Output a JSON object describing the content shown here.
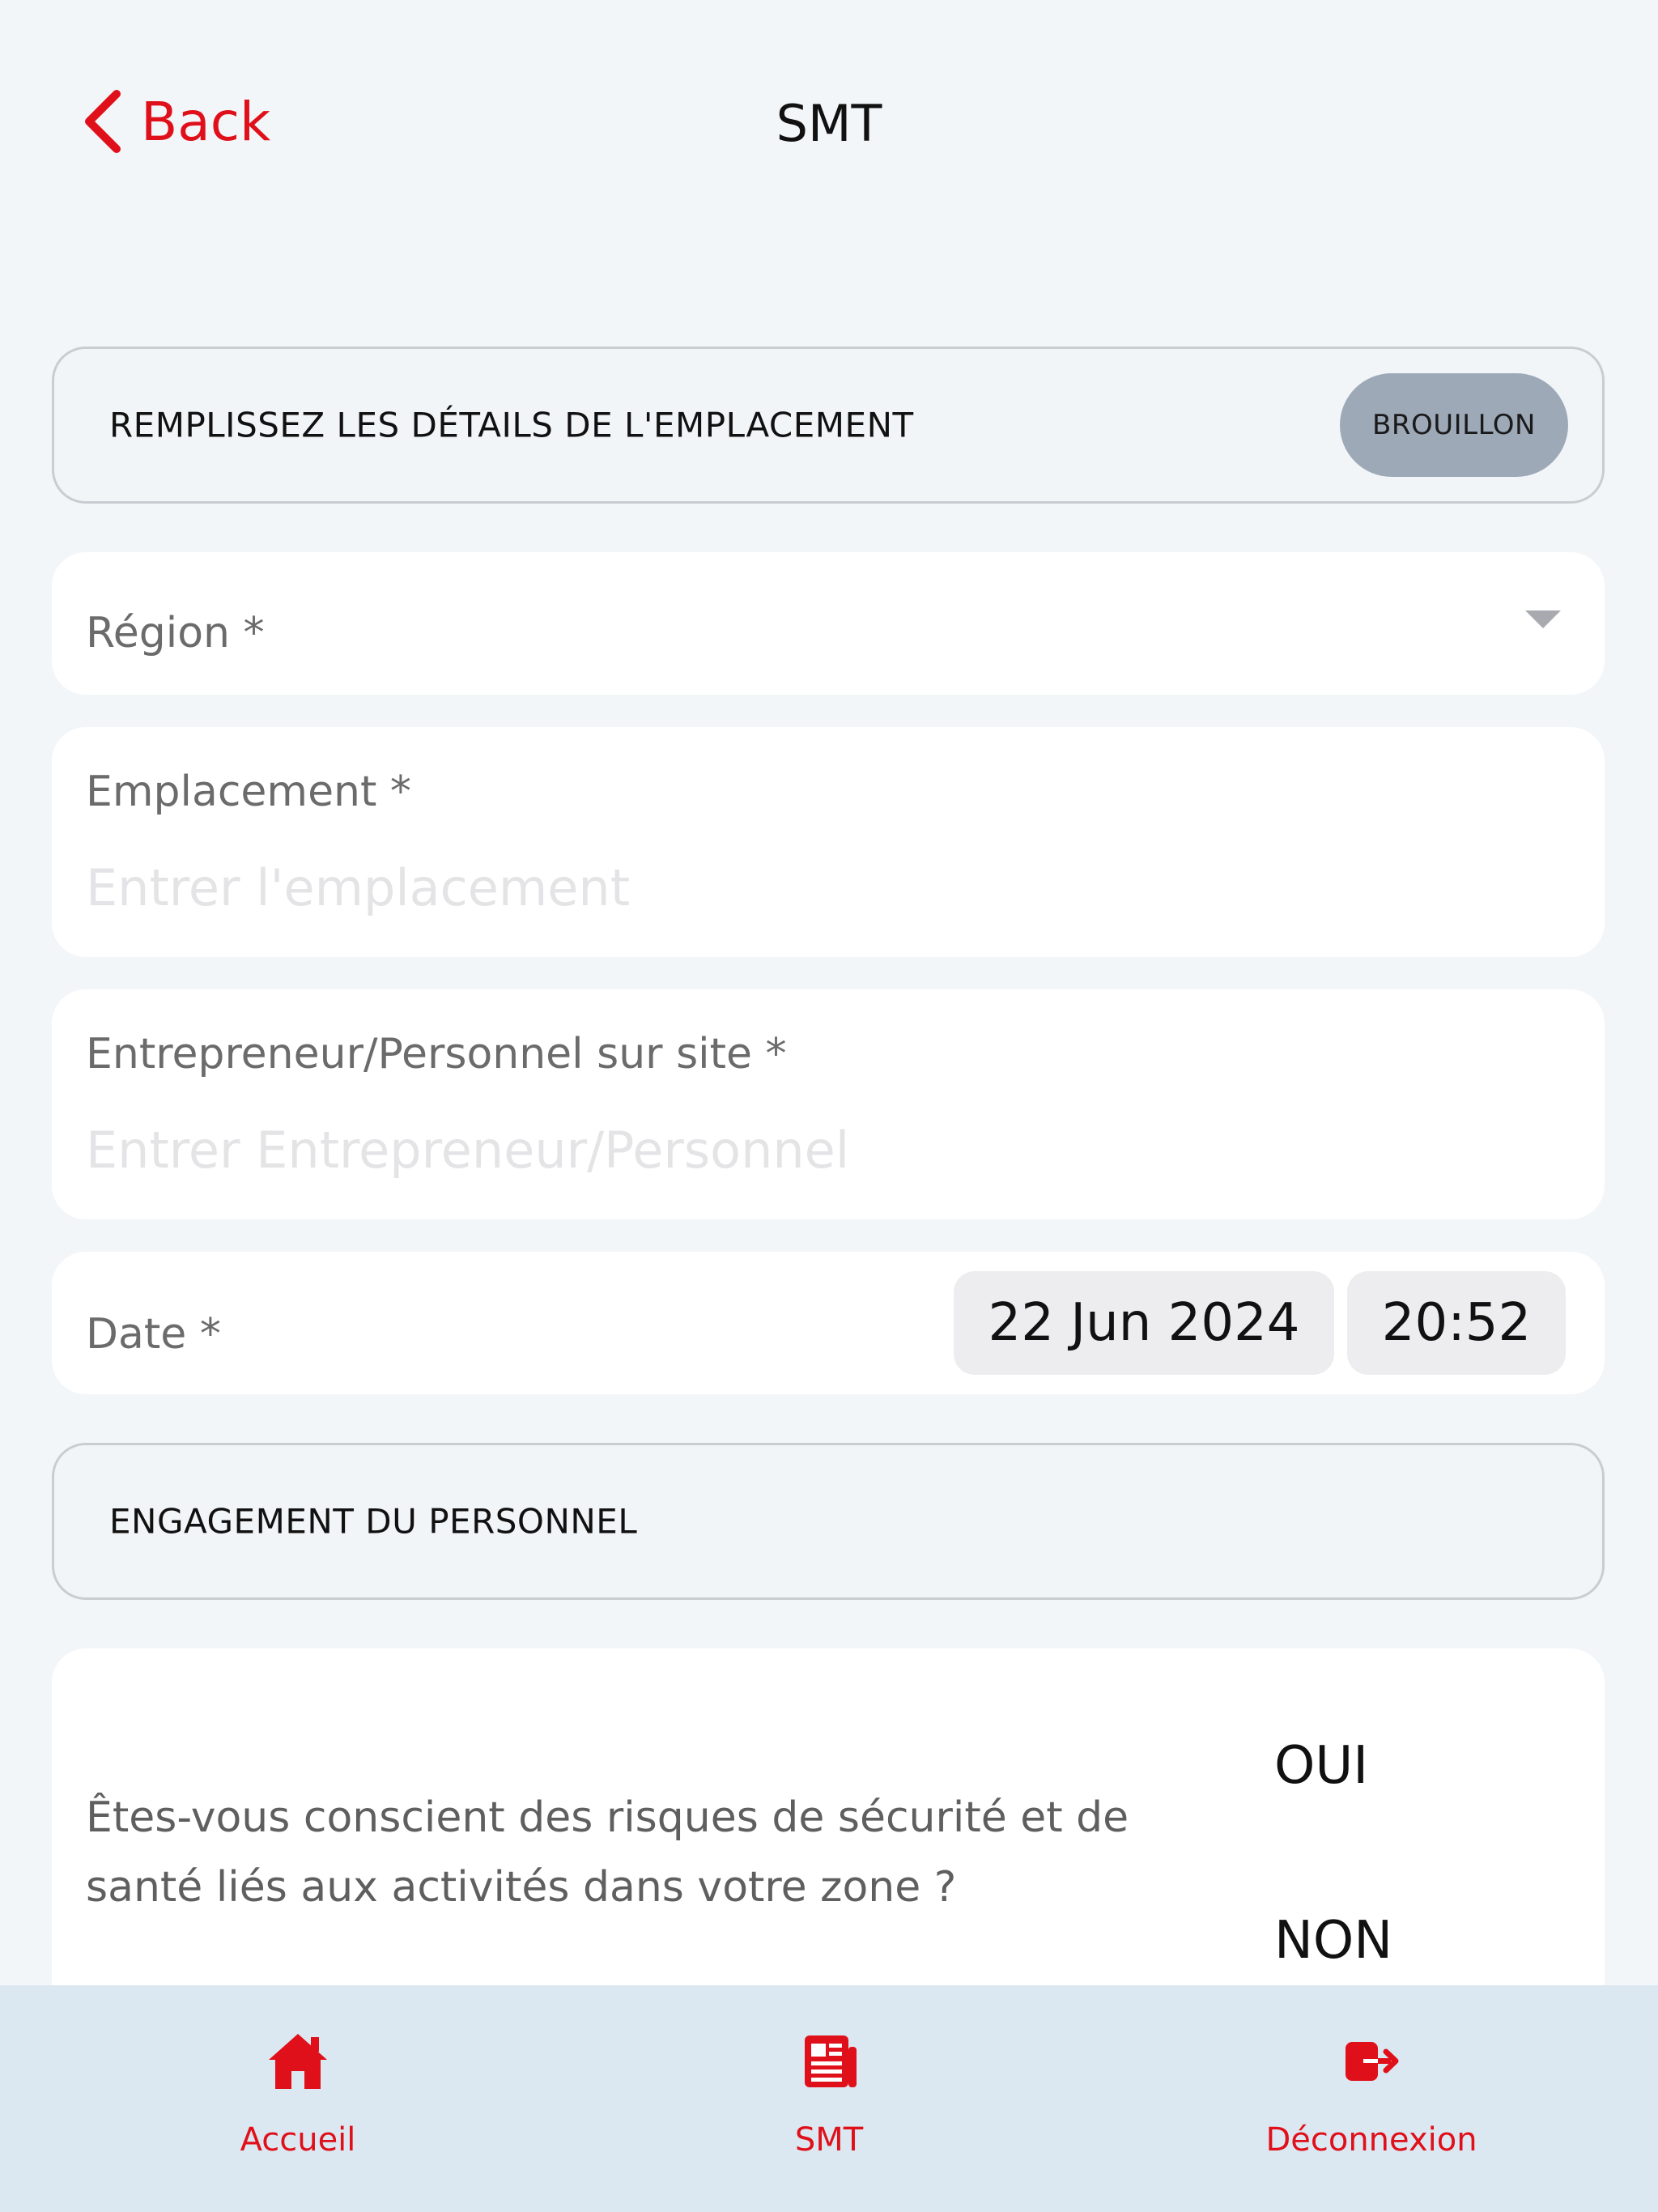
{
  "header": {
    "back_label": "Back",
    "title": "SMT"
  },
  "location_section": {
    "title": "REMPLISSEZ LES DÉTAILS DE L'EMPLACEMENT",
    "badge": "BROUILLON"
  },
  "region": {
    "label": "Région *"
  },
  "emplacement": {
    "label": "Emplacement *",
    "placeholder": "Entrer l'emplacement",
    "value": ""
  },
  "entrepreneur": {
    "label": "Entrepreneur/Personnel sur site *",
    "placeholder": "Entrer Entrepreneur/Personnel",
    "value": ""
  },
  "date_field": {
    "label": "Date *",
    "date": "22 Jun 2024",
    "time": "20:52"
  },
  "engagement_section": {
    "title": "ENGAGEMENT DU PERSONNEL"
  },
  "question1": {
    "text": "Êtes-vous conscient des risques de sécurité et de santé liés aux activités dans votre zone ?",
    "options": [
      "OUI",
      "NON"
    ]
  },
  "tabbar": {
    "items": [
      {
        "label": "Accueil",
        "icon": "home-icon"
      },
      {
        "label": "SMT",
        "icon": "newspaper-icon"
      },
      {
        "label": "Déconnexion",
        "icon": "logout-icon"
      }
    ]
  },
  "colors": {
    "accent": "#e0101a",
    "background": "#f2f6f9",
    "badge": "#9ea9b8",
    "tabbar": "#dce8f1"
  }
}
